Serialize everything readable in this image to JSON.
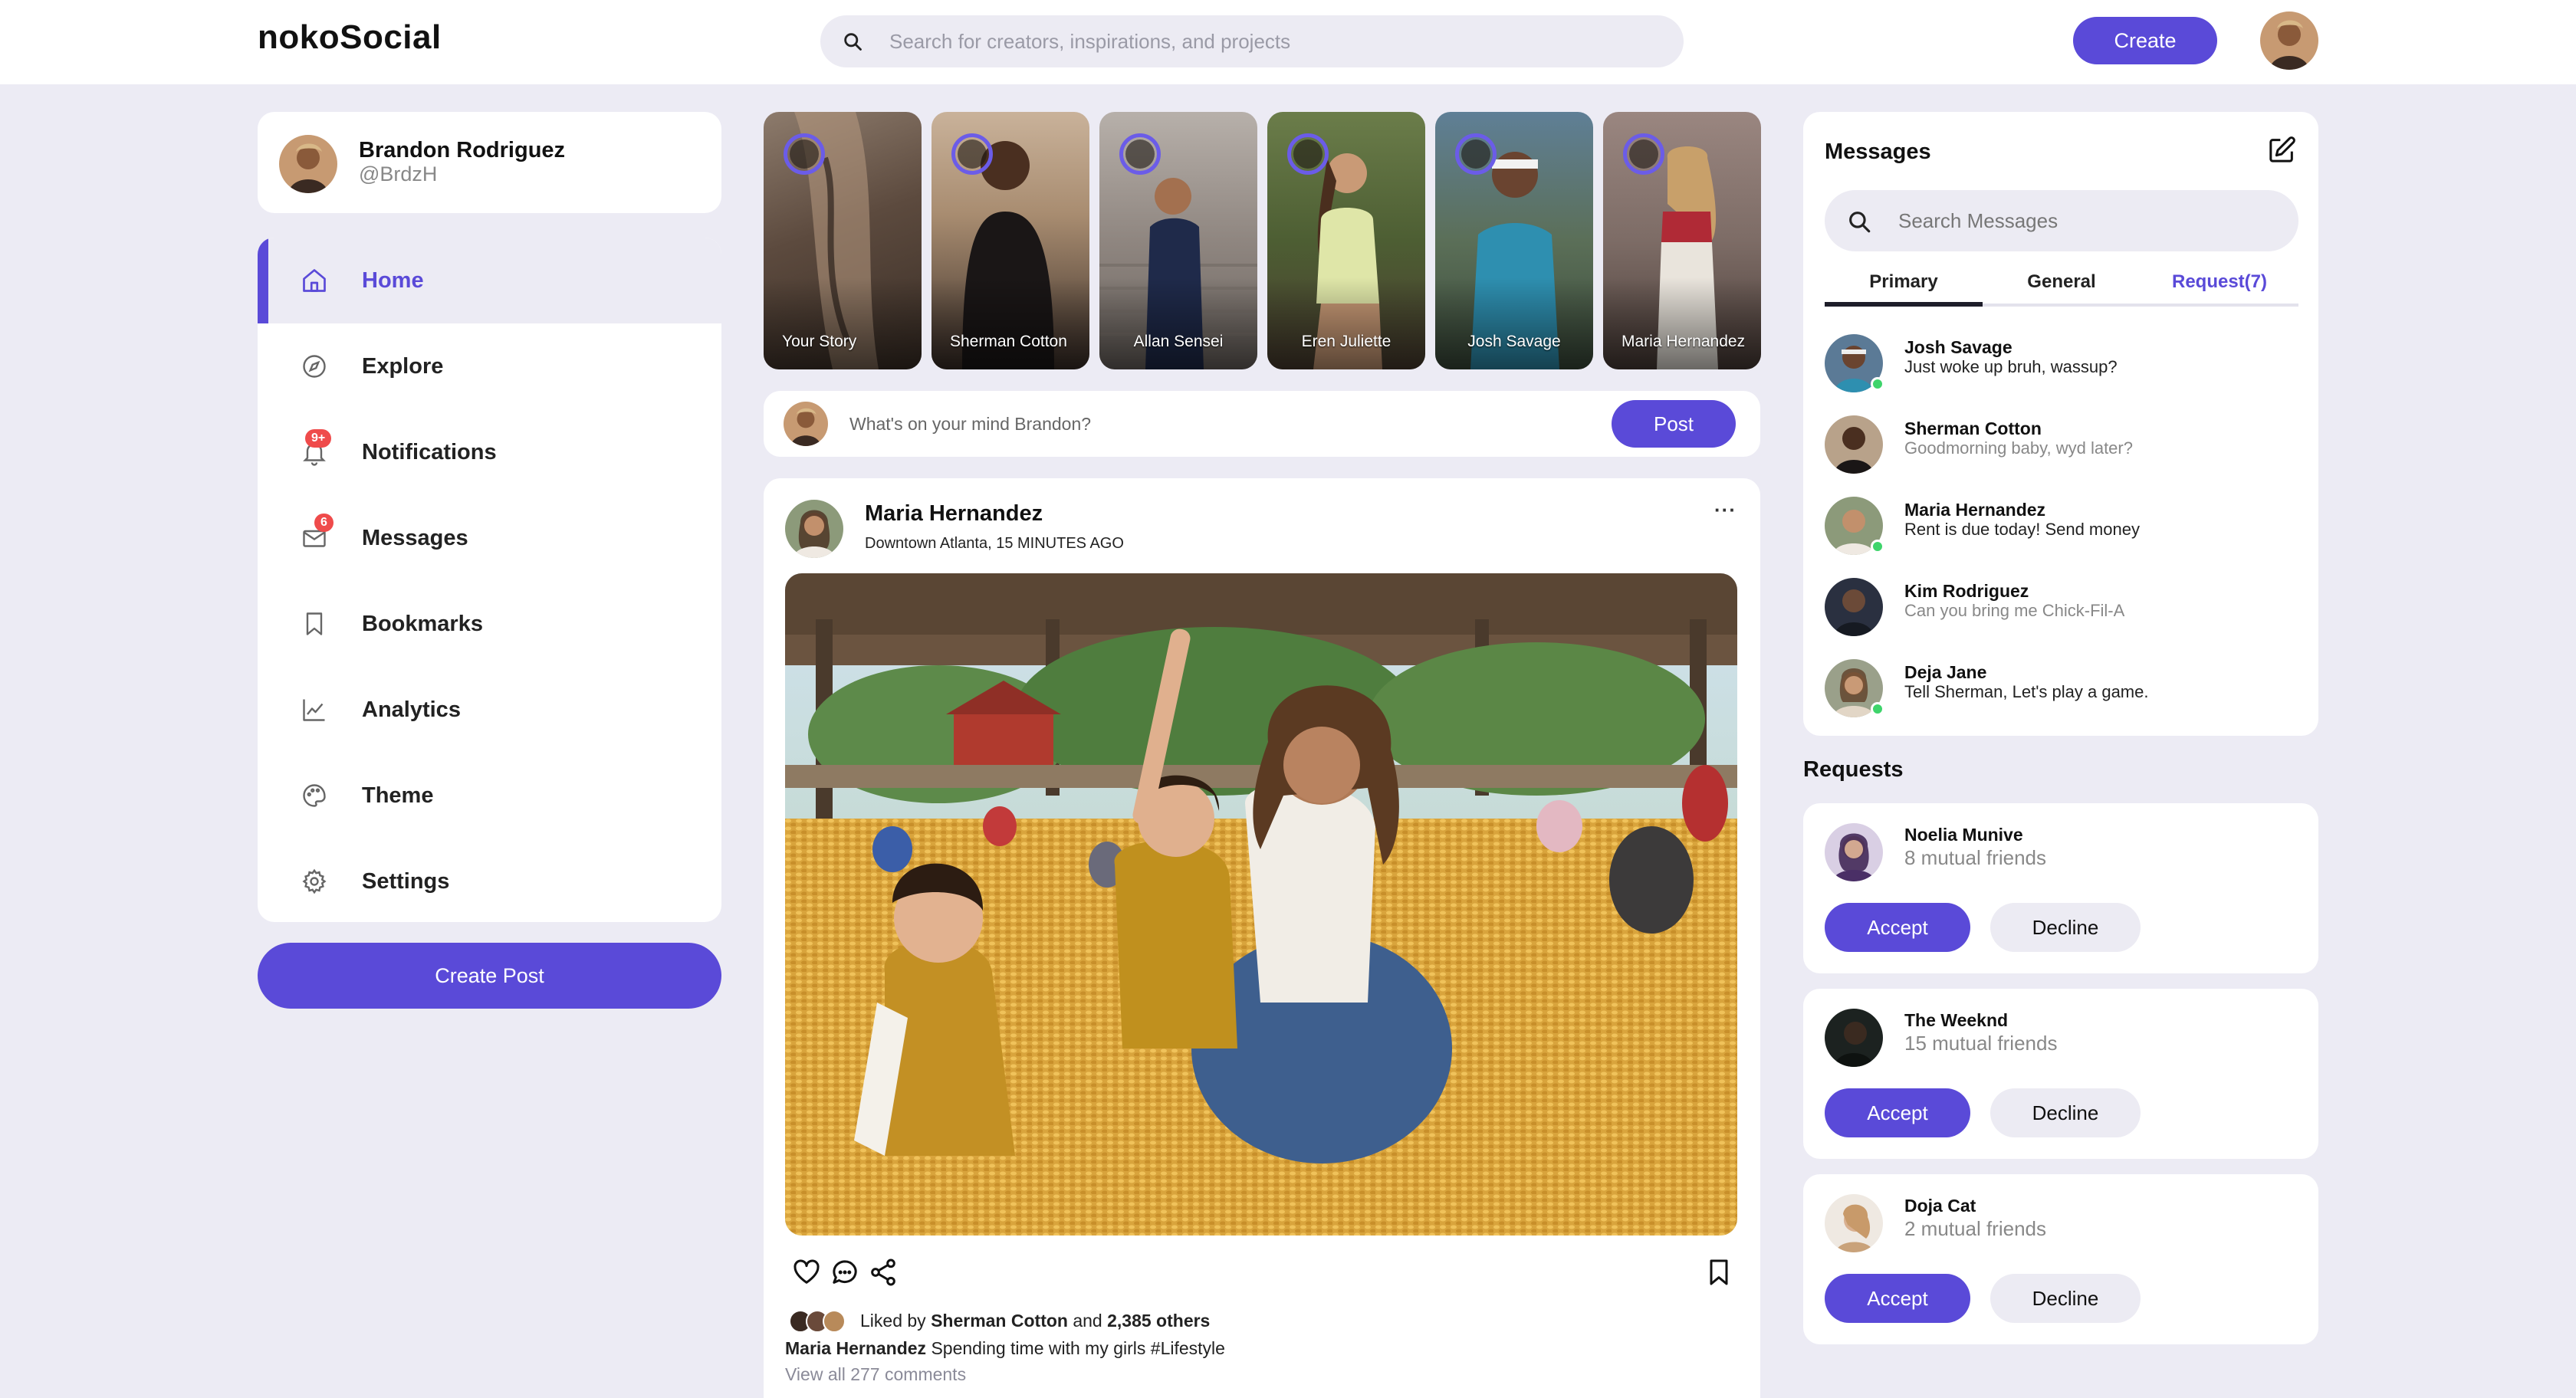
{
  "app": {
    "name": "nokoSocial"
  },
  "topbar": {
    "search_placeholder": "Search for creators, inspirations, and projects",
    "create_label": "Create"
  },
  "profile": {
    "name": "Brandon Rodriguez",
    "handle": "@BrdzH"
  },
  "nav": {
    "items": [
      {
        "label": "Home",
        "icon": "home-icon",
        "active": true
      },
      {
        "label": "Explore",
        "icon": "compass-icon"
      },
      {
        "label": "Notifications",
        "icon": "bell-icon",
        "badge": "9+"
      },
      {
        "label": "Messages",
        "icon": "envelope-icon",
        "badge": "6"
      },
      {
        "label": "Bookmarks",
        "icon": "bookmark-icon"
      },
      {
        "label": "Analytics",
        "icon": "chart-icon"
      },
      {
        "label": "Theme",
        "icon": "palette-icon"
      },
      {
        "label": "Settings",
        "icon": "gear-icon"
      }
    ],
    "create_post_label": "Create Post"
  },
  "stories": [
    {
      "label": "Your Story"
    },
    {
      "label": "Sherman Cotton"
    },
    {
      "label": "Allan Sensei"
    },
    {
      "label": "Eren Juliette"
    },
    {
      "label": "Josh Savage"
    },
    {
      "label": "Maria Hernandez"
    }
  ],
  "composer": {
    "placeholder": "What's on your mind Brandon?",
    "post_label": "Post"
  },
  "post": {
    "author": "Maria Hernandez",
    "location": "Downtown Atlanta, 15 MINUTES AGO",
    "more": "···",
    "liked_prefix": "Liked by",
    "liked_by": "Sherman Cotton",
    "liked_and": "and",
    "liked_others": "2,385 others",
    "caption_author": "Maria Hernandez",
    "caption_text": "Spending time with my girls #Lifestyle",
    "view_comments": "View all 277 comments"
  },
  "messages": {
    "title": "Messages",
    "search_placeholder": "Search Messages",
    "tabs": [
      "Primary",
      "General",
      "Request(7)"
    ],
    "active_tab": "Primary",
    "conversations": [
      {
        "name": "Josh Savage",
        "text": "Just woke up bruh, wassup?",
        "online": true,
        "unread": true
      },
      {
        "name": "Sherman Cotton",
        "text": "Goodmorning baby, wyd later?",
        "online": false,
        "unread": false
      },
      {
        "name": "Maria Hernandez",
        "text": "Rent is due today! Send money",
        "online": true,
        "unread": true
      },
      {
        "name": "Kim Rodriguez",
        "text": "Can you bring me Chick-Fil-A",
        "online": false,
        "unread": false
      },
      {
        "name": "Deja Jane",
        "text": "Tell Sherman, Let's play a game.",
        "online": true,
        "unread": true
      }
    ]
  },
  "requests": {
    "title": "Requests",
    "accept_label": "Accept",
    "decline_label": "Decline",
    "items": [
      {
        "name": "Noelia Munive",
        "mutual": "8 mutual friends"
      },
      {
        "name": "The Weeknd",
        "mutual": "15 mutual friends"
      },
      {
        "name": "Doja Cat",
        "mutual": "2 mutual friends"
      }
    ]
  },
  "colors": {
    "accent": "#5a4ad8",
    "background": "#ecebf4",
    "badge": "#ef4b4b",
    "online": "#3ed46b"
  }
}
